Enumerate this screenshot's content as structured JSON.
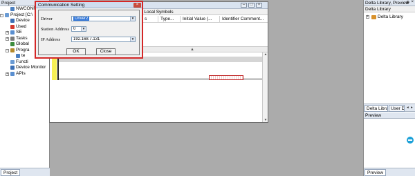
{
  "project_panel": {
    "title": "Project",
    "tab": "Project",
    "tree": [
      {
        "label": "NWCONFIG",
        "level": 1,
        "expander": "",
        "icon_color": "#4a7fc1"
      },
      {
        "label": "Project [C:\\",
        "level": 0,
        "expander": "−",
        "icon_color": "#6a9bd4"
      },
      {
        "label": "Device",
        "level": 1,
        "expander": "",
        "icon_color": "#3b6fb5"
      },
      {
        "label": "Used",
        "level": 1,
        "expander": "",
        "icon_color": "#d43a2f"
      },
      {
        "label": "SE",
        "level": 1,
        "expander": "+",
        "icon_color": "#5a8fd0"
      },
      {
        "label": "Tasks",
        "level": 1,
        "expander": "+",
        "icon_color": "#7b7b7b"
      },
      {
        "label": "Global",
        "level": 1,
        "expander": "",
        "icon_color": "#3e8d3e"
      },
      {
        "label": "Progra",
        "level": 1,
        "expander": "−",
        "icon_color": "#b58a2a"
      },
      {
        "label": "te",
        "level": 2,
        "expander": "",
        "icon_color": "#4a7fc1"
      },
      {
        "label": "Functi",
        "level": 1,
        "expander": "",
        "icon_color": "#6a9bd4"
      },
      {
        "label": "Device Monitor",
        "level": 1,
        "expander": "",
        "icon_color": "#3b6fb5"
      },
      {
        "label": "APIs",
        "level": 1,
        "expander": "+",
        "icon_color": "#5a8fd0"
      }
    ]
  },
  "editor": {
    "local_symbols_title": "Local Symbols",
    "columns": [
      "s",
      "Type...",
      "Initial Value (...",
      "Identifier Comment..."
    ]
  },
  "dialog": {
    "title": "Communication Setting",
    "close_symbol": "×",
    "driver_label": "Driver",
    "driver_value": "Driver2",
    "station_label": "Station Address",
    "station_value": "0",
    "ip_label": "IP Address",
    "ip_value": "192.168.7.131",
    "ok_label": "OK",
    "close_label": "Close",
    "highlight_color": "#d42727"
  },
  "library_panel": {
    "title": "Delta Library, Preview",
    "subtitle": "Delta Library",
    "tree_item": "Delta Library",
    "tabs": [
      "Delta Library",
      "User D"
    ]
  },
  "preview_panel": {
    "title": "Preview",
    "tab": "Preview"
  }
}
